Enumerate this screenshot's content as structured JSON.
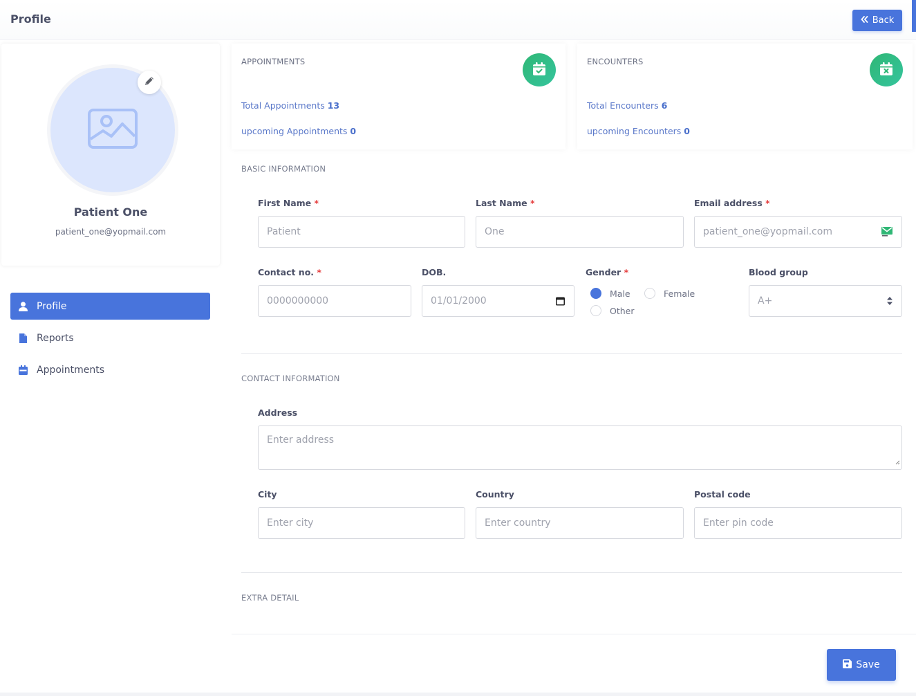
{
  "header": {
    "title": "Profile",
    "back_label": "Back"
  },
  "profile": {
    "name": "Patient One",
    "email": "patient_one@yopmail.com"
  },
  "sidebar": {
    "items": [
      {
        "label": "Profile",
        "icon": "user-icon",
        "active": true
      },
      {
        "label": "Reports",
        "icon": "file-icon",
        "active": false
      },
      {
        "label": "Appointments",
        "icon": "calendar-icon",
        "active": false
      }
    ]
  },
  "stats": {
    "appointments": {
      "title": "APPOINTMENTS",
      "icon": "calendar-check-icon",
      "total_label": "Total Appointments",
      "total_value": "13",
      "upcoming_label": "upcoming Appointments",
      "upcoming_value": "0"
    },
    "encounters": {
      "title": "ENCOUNTERS",
      "icon": "calendar-x-icon",
      "total_label": "Total Encounters",
      "total_value": "6",
      "upcoming_label": "upcoming Encounters",
      "upcoming_value": "0"
    },
    "accent": "#2fb775"
  },
  "basic_info": {
    "section_title": "BASIC INFORMATION",
    "first_name": {
      "label": "First Name",
      "required": "*",
      "value": "Patient"
    },
    "last_name": {
      "label": "Last Name",
      "required": "*",
      "value": "One"
    },
    "email": {
      "label": "Email address",
      "required": "*",
      "value": "patient_one@yopmail.com"
    },
    "contact": {
      "label": "Contact no.",
      "required": "*",
      "value": "0000000000"
    },
    "dob": {
      "label": "DOB.",
      "value": "01/01/2000"
    },
    "gender": {
      "label": "Gender",
      "required": "*",
      "options": [
        "Male",
        "Female",
        "Other"
      ],
      "selected": "Male"
    },
    "blood_group": {
      "label": "Blood group",
      "value": "A+"
    }
  },
  "contact_info": {
    "section_title": "CONTACT INFORMATION",
    "address": {
      "label": "Address",
      "placeholder": "Enter address"
    },
    "city": {
      "label": "City",
      "placeholder": "Enter city"
    },
    "country": {
      "label": "Country",
      "placeholder": "Enter country"
    },
    "postal_code": {
      "label": "Postal code",
      "placeholder": "Enter pin code"
    }
  },
  "extra_detail": {
    "section_title": "EXTRA DETAIL"
  },
  "footer": {
    "save_label": "Save"
  },
  "colors": {
    "primary": "#4874dc",
    "success": "#2fb775",
    "required": "#e53c3c"
  }
}
